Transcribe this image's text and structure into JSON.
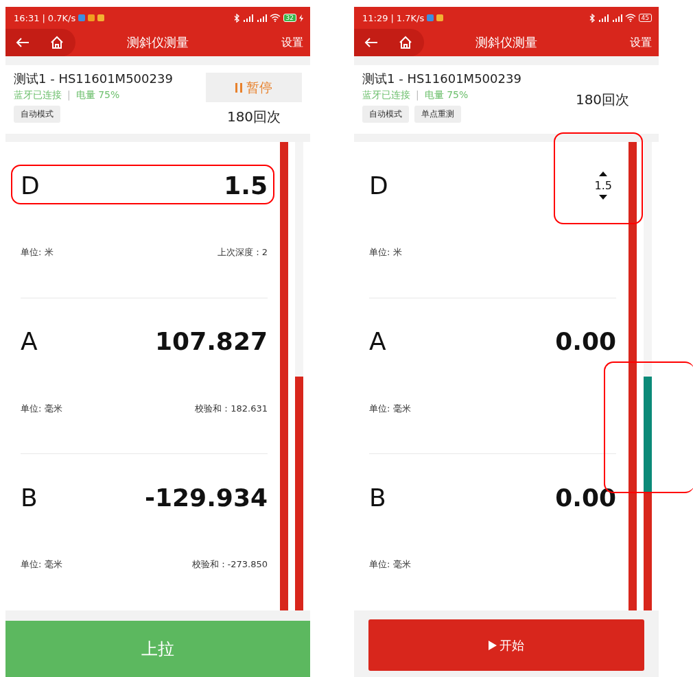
{
  "screens": [
    {
      "status_bar": {
        "time": "16:31",
        "separator": "|",
        "speed": "0.7K/s",
        "app_icons": [
          {
            "color": "#3d8fe0"
          },
          {
            "color": "#f0a020"
          },
          {
            "color": "#f2b233"
          }
        ],
        "battery": "32",
        "charging": true
      },
      "app_bar": {
        "title": "测斜仪测量",
        "action": "设置"
      },
      "device": {
        "name": "测试1 - HS11601M500239",
        "bluetooth": "蓝牙已连接",
        "separator": "|",
        "battery": "电量 75%"
      },
      "mode_buttons": [
        "自动模式"
      ],
      "pause_button": {
        "label": "暂停"
      },
      "count": "180回次",
      "rows": [
        {
          "label": "D",
          "value": "1.5",
          "kind": "plain",
          "unit": "单位: 米",
          "note": "上次深度：2",
          "highlighted": true
        },
        {
          "label": "A",
          "value": "107.827",
          "kind": "plain",
          "unit": "单位: 毫米",
          "note": "校验和：182.631",
          "highlighted": false
        },
        {
          "label": "B",
          "value": "-129.934",
          "kind": "plain",
          "unit": "单位: 毫米",
          "note": "校验和：-273.850",
          "highlighted": false
        }
      ],
      "bars": [
        {
          "fills": [
            {
              "color": "#d8261c",
              "level": 1
            }
          ]
        },
        {
          "fills": [
            {
              "color": "#d8261c",
              "level": 0.5
            }
          ]
        }
      ],
      "bars_highlighted": false,
      "action_button": {
        "label": "上拉",
        "kind": "full"
      }
    },
    {
      "status_bar": {
        "time": "11:29",
        "separator": "|",
        "speed": "1.7K/s",
        "app_icons": [
          {
            "color": "#3d8fe0"
          },
          {
            "color": "#f2b233"
          }
        ],
        "battery": "45",
        "charging": false
      },
      "app_bar": {
        "title": "测斜仪测量",
        "action": "设置"
      },
      "device": {
        "name": "测试1 - HS11601M500239",
        "bluetooth": "蓝牙已连接",
        "separator": "|",
        "battery": "电量 75%"
      },
      "mode_buttons": [
        "自动模式",
        "单点重测"
      ],
      "count": "180回次",
      "rows": [
        {
          "label": "D",
          "value": "1.5",
          "kind": "stepper",
          "unit": "单位: 米",
          "highlighted": true
        },
        {
          "label": "A",
          "value": "0.00",
          "kind": "plain",
          "unit": "单位: 毫米",
          "highlighted": false
        },
        {
          "label": "B",
          "value": "0.00",
          "kind": "plain",
          "unit": "单位: 毫米",
          "highlighted": false
        }
      ],
      "bars": [
        {
          "fills": [
            {
              "color": "#d8261c",
              "level": 1
            }
          ]
        },
        {
          "fills": [
            {
              "color": "#0b8a78",
              "level": 0.5
            },
            {
              "color": "#d8261c",
              "level": 0.25
            }
          ]
        }
      ],
      "bars_highlighted": true,
      "action_button": {
        "label": "开始",
        "kind": "start"
      }
    }
  ]
}
